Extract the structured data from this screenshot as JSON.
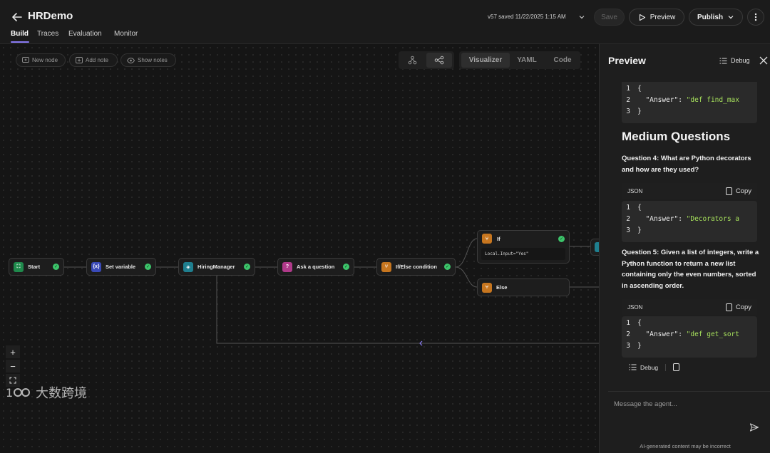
{
  "header": {
    "title": "HRDemo",
    "tabs": [
      {
        "label": "Build"
      },
      {
        "label": "Traces"
      },
      {
        "label": "Evaluation"
      },
      {
        "label": "Monitor"
      }
    ],
    "saved_status": "v57 saved 11/22/2025 1:15 AM",
    "save_label": "Save",
    "preview_label": "Preview",
    "publish_label": "Publish"
  },
  "canvas": {
    "toolbar": {
      "new_node": "New node",
      "add_note": "Add note",
      "show_notes": "Show notes"
    },
    "modes": {
      "visualizer": "Visualizer",
      "yaml": "YAML",
      "code": "Code"
    },
    "nodes": {
      "start": "Start",
      "set_variable": "Set variable",
      "hiring_manager": "HiringManager",
      "ask_question": "Ask a question",
      "if_else": "If/Else condition",
      "if": "If",
      "if_condition": "Local.Input=\"Yes\"",
      "else": "Else"
    },
    "zoom": {
      "in": "+",
      "out": "−"
    }
  },
  "watermark": "大数跨境",
  "panel": {
    "title": "Preview",
    "debug_label": "Debug",
    "code_top": {
      "lines": [
        {
          "n": "1",
          "text": "{"
        },
        {
          "n": "2",
          "key": "  \"Answer\": ",
          "str": "\"def find_max"
        },
        {
          "n": "3",
          "text": "}"
        }
      ]
    },
    "heading": "Medium Questions",
    "question4": "Question 4: What are Python decorators and how are they used?",
    "block4": {
      "lang": "JSON",
      "copy": "Copy",
      "lines": [
        {
          "n": "1",
          "text": "{"
        },
        {
          "n": "2",
          "key": "  \"Answer\": ",
          "str": "\"Decorators a"
        },
        {
          "n": "3",
          "text": "}"
        }
      ]
    },
    "question5": "Question 5: Given a list of integers, write a Python function to return a new list containing only the even numbers, sorted in ascending order.",
    "block5": {
      "lang": "JSON",
      "copy": "Copy",
      "lines": [
        {
          "n": "1",
          "text": "{"
        },
        {
          "n": "2",
          "key": "  \"Answer\": ",
          "str": "\"def get_sort"
        },
        {
          "n": "3",
          "text": "}"
        }
      ]
    },
    "message_debug": "Debug",
    "input_placeholder": "Message the agent...",
    "disclaimer": "AI-generated content may be incorrect"
  },
  "colors": {
    "accent": "#8b7cf6",
    "success": "#3cc46a",
    "code_string": "#a6e05c",
    "icon_start": "#1f8a4c",
    "icon_setvar": "#3a4ab8",
    "icon_agent": "#1f7f8f",
    "icon_question": "#b03a8a",
    "icon_condition": "#c7761f"
  },
  "icons": [
    "back-arrow-icon",
    "chevron-down-icon",
    "play-icon",
    "more-vertical-icon",
    "debug-list-icon",
    "close-icon",
    "copy-icon",
    "send-icon"
  ]
}
